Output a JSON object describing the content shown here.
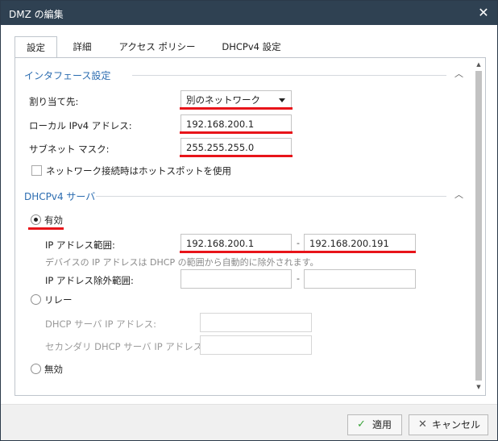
{
  "window": {
    "title": "DMZ の編集"
  },
  "tabs": [
    {
      "label": "設定"
    },
    {
      "label": "詳細"
    },
    {
      "label": "アクセス ポリシー"
    },
    {
      "label": "DHCPv4 設定"
    }
  ],
  "interface": {
    "title": "インタフェース設定",
    "assign_label": "割り当て先:",
    "assign_value": "別のネットワーク",
    "ipv4_label": "ローカル IPv4 アドレス:",
    "ipv4_value": "192.168.200.1",
    "mask_label": "サブネット マスク:",
    "mask_value": "255.255.255.0",
    "hotspot_label": "ネットワーク接続時はホットスポットを使用"
  },
  "dhcp": {
    "title": "DHCPv4 サーバ",
    "enabled_label": "有効",
    "range_label": "IP アドレス範囲:",
    "range_start": "192.168.200.1",
    "range_end": "192.168.200.191",
    "range_hint": "デバイスの IP アドレスは DHCP の範囲から自動的に除外されます。",
    "exclude_label": "IP アドレス除外範囲:",
    "relay_label": "リレー",
    "relay_server_label": "DHCP サーバ IP アドレス:",
    "relay_secondary_label": "セカンダリ DHCP サーバ IP アドレス:",
    "disabled_label": "無効",
    "range_separator": "-"
  },
  "footer": {
    "apply_label": "適用",
    "cancel_label": "キャンセル"
  },
  "colors": {
    "titlebar": "#2f4152",
    "section_title": "#2b6cb0",
    "highlight": "#e8141a",
    "apply_check": "#3aa33a"
  }
}
